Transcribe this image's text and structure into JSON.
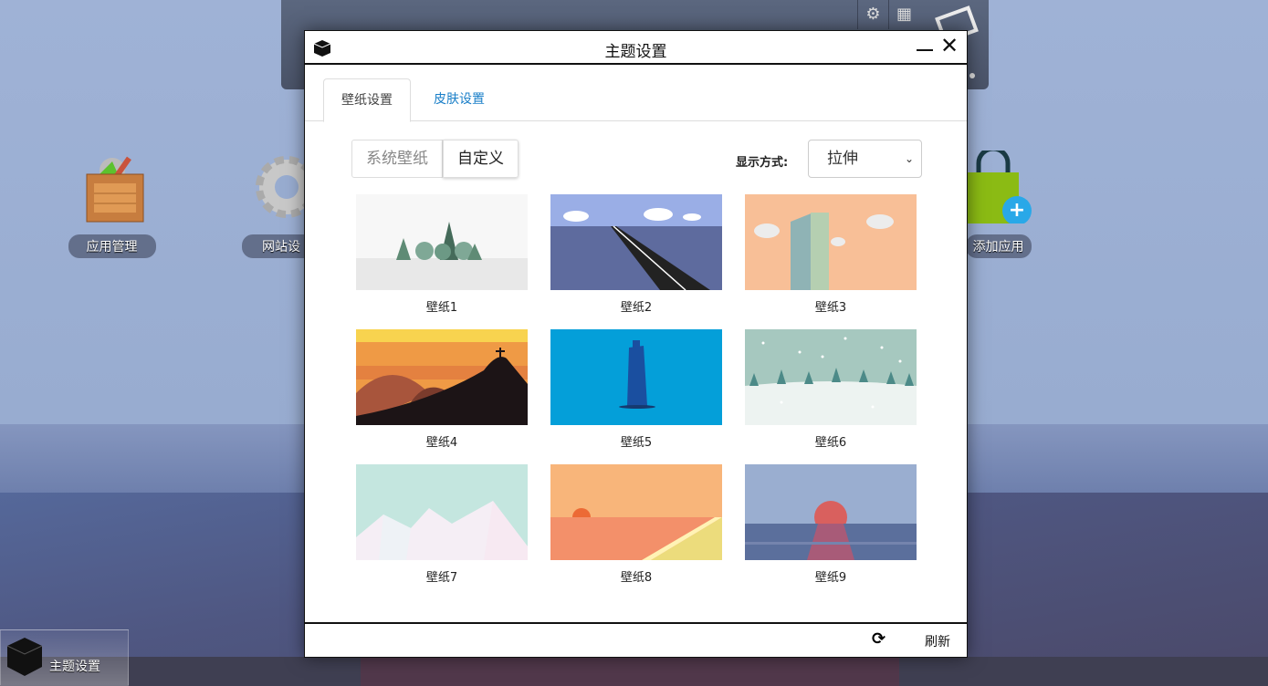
{
  "desktop": {
    "icons": [
      {
        "label": "应用管理",
        "icon": "app-box-icon"
      },
      {
        "label": "网站设",
        "icon": "gear-icon"
      },
      {
        "label": "添加应用",
        "icon": "shopping-bag-plus-icon"
      }
    ]
  },
  "taskbar": {
    "item": "主题设置"
  },
  "dialog": {
    "title": "主题设置",
    "tabs": [
      {
        "label": "壁纸设置",
        "active": true
      },
      {
        "label": "皮肤设置",
        "active": false
      }
    ],
    "source": {
      "options": [
        "系统壁纸",
        "自定义"
      ],
      "selected": "自定义"
    },
    "display_mode": {
      "label": "显示方式:",
      "value": "拉伸"
    },
    "wallpapers": [
      "壁纸1",
      "壁纸2",
      "壁纸3",
      "壁纸4",
      "壁纸5",
      "壁纸6",
      "壁纸7",
      "壁纸8",
      "壁纸9"
    ],
    "footer": {
      "refresh": "刷新"
    }
  },
  "colors": {
    "tab_link": "#1a7fc8",
    "accent_blue": "#2aa5e0"
  }
}
